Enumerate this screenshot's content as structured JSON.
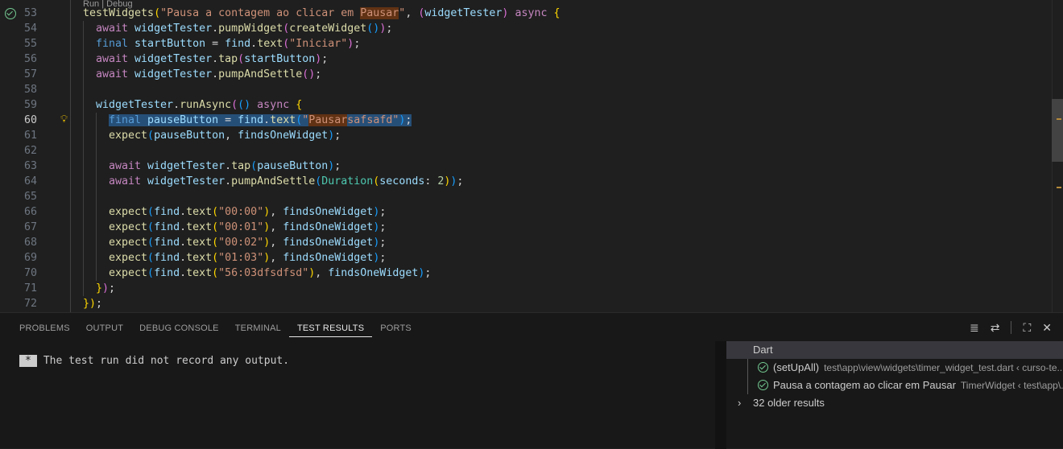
{
  "editor": {
    "codelens": "Run | Debug",
    "lines": [
      {
        "n": "53",
        "indent": 2,
        "tokens": [
          [
            "testWidgets",
            "f"
          ],
          [
            "(",
            "y"
          ],
          [
            "\"Pausa a contagem ao clicar em ",
            "s"
          ],
          [
            "Pausar",
            "s match"
          ],
          [
            "\"",
            "s"
          ],
          [
            ", ",
            "p"
          ],
          [
            "(",
            "m"
          ],
          [
            "widgetTester",
            "v"
          ],
          [
            ")",
            "m"
          ],
          [
            " async ",
            "k"
          ],
          [
            "{",
            "y"
          ]
        ]
      },
      {
        "n": "54",
        "indent": 4,
        "tokens": [
          [
            "await ",
            "k"
          ],
          [
            "widgetTester",
            "v"
          ],
          [
            ".",
            "p"
          ],
          [
            "pumpWidget",
            "f"
          ],
          [
            "(",
            "m"
          ],
          [
            "createWidget",
            "f"
          ],
          [
            "()",
            "c"
          ],
          [
            ")",
            "m"
          ],
          [
            ";",
            "p"
          ]
        ]
      },
      {
        "n": "55",
        "indent": 4,
        "tokens": [
          [
            "final ",
            "b"
          ],
          [
            "startButton",
            "v"
          ],
          [
            " = ",
            "p"
          ],
          [
            "find",
            "v"
          ],
          [
            ".",
            "p"
          ],
          [
            "text",
            "f"
          ],
          [
            "(",
            "m"
          ],
          [
            "\"Iniciar\"",
            "s"
          ],
          [
            ")",
            "m"
          ],
          [
            ";",
            "p"
          ]
        ]
      },
      {
        "n": "56",
        "indent": 4,
        "tokens": [
          [
            "await ",
            "k"
          ],
          [
            "widgetTester",
            "v"
          ],
          [
            ".",
            "p"
          ],
          [
            "tap",
            "f"
          ],
          [
            "(",
            "m"
          ],
          [
            "startButton",
            "v"
          ],
          [
            ")",
            "m"
          ],
          [
            ";",
            "p"
          ]
        ]
      },
      {
        "n": "57",
        "indent": 4,
        "tokens": [
          [
            "await ",
            "k"
          ],
          [
            "widgetTester",
            "v"
          ],
          [
            ".",
            "p"
          ],
          [
            "pumpAndSettle",
            "f"
          ],
          [
            "()",
            "m"
          ],
          [
            ";",
            "p"
          ]
        ]
      },
      {
        "n": "58",
        "indent": 0,
        "tokens": []
      },
      {
        "n": "59",
        "indent": 4,
        "tokens": [
          [
            "widgetTester",
            "v"
          ],
          [
            ".",
            "p"
          ],
          [
            "runAsync",
            "f"
          ],
          [
            "(",
            "m"
          ],
          [
            "()",
            "c"
          ],
          [
            " async ",
            "k"
          ],
          [
            "{",
            "y"
          ]
        ]
      },
      {
        "n": "60",
        "indent": 6,
        "current": true,
        "tokens": [
          [
            "final ",
            "b hl"
          ],
          [
            "pauseButton",
            "v hl"
          ],
          [
            " = ",
            "p hl"
          ],
          [
            "find",
            "v hl"
          ],
          [
            ".",
            "p hl"
          ],
          [
            "text",
            "f hl"
          ],
          [
            "(",
            "c hl"
          ],
          [
            "\"",
            "s hl"
          ],
          [
            "Pausar",
            "s hl match"
          ],
          [
            "safsafd\"",
            "s hl"
          ],
          [
            ")",
            "c hl"
          ],
          [
            ";",
            "p hl"
          ]
        ]
      },
      {
        "n": "61",
        "indent": 6,
        "tokens": [
          [
            "expect",
            "f"
          ],
          [
            "(",
            "c"
          ],
          [
            "pauseButton",
            "v"
          ],
          [
            ", ",
            "p"
          ],
          [
            "findsOneWidget",
            "v"
          ],
          [
            ")",
            "c"
          ],
          [
            ";",
            "p"
          ]
        ]
      },
      {
        "n": "62",
        "indent": 0,
        "tokens": []
      },
      {
        "n": "63",
        "indent": 6,
        "tokens": [
          [
            "await ",
            "k"
          ],
          [
            "widgetTester",
            "v"
          ],
          [
            ".",
            "p"
          ],
          [
            "tap",
            "f"
          ],
          [
            "(",
            "c"
          ],
          [
            "pauseButton",
            "v"
          ],
          [
            ")",
            "c"
          ],
          [
            ";",
            "p"
          ]
        ]
      },
      {
        "n": "64",
        "indent": 6,
        "tokens": [
          [
            "await ",
            "k"
          ],
          [
            "widgetTester",
            "v"
          ],
          [
            ".",
            "p"
          ],
          [
            "pumpAndSettle",
            "f"
          ],
          [
            "(",
            "c"
          ],
          [
            "Duration",
            "t"
          ],
          [
            "(",
            "y"
          ],
          [
            "seconds",
            "v"
          ],
          [
            ": ",
            "p"
          ],
          [
            "2",
            "n"
          ],
          [
            ")",
            "y"
          ],
          [
            ")",
            "c"
          ],
          [
            ";",
            "p"
          ]
        ]
      },
      {
        "n": "65",
        "indent": 0,
        "tokens": []
      },
      {
        "n": "66",
        "indent": 6,
        "tokens": [
          [
            "expect",
            "f"
          ],
          [
            "(",
            "c"
          ],
          [
            "find",
            "v"
          ],
          [
            ".",
            "p"
          ],
          [
            "text",
            "f"
          ],
          [
            "(",
            "y"
          ],
          [
            "\"00:00\"",
            "s"
          ],
          [
            ")",
            "y"
          ],
          [
            ", ",
            "p"
          ],
          [
            "findsOneWidget",
            "v"
          ],
          [
            ")",
            "c"
          ],
          [
            ";",
            "p"
          ]
        ]
      },
      {
        "n": "67",
        "indent": 6,
        "tokens": [
          [
            "expect",
            "f"
          ],
          [
            "(",
            "c"
          ],
          [
            "find",
            "v"
          ],
          [
            ".",
            "p"
          ],
          [
            "text",
            "f"
          ],
          [
            "(",
            "y"
          ],
          [
            "\"00:01\"",
            "s"
          ],
          [
            ")",
            "y"
          ],
          [
            ", ",
            "p"
          ],
          [
            "findsOneWidget",
            "v"
          ],
          [
            ")",
            "c"
          ],
          [
            ";",
            "p"
          ]
        ]
      },
      {
        "n": "68",
        "indent": 6,
        "tokens": [
          [
            "expect",
            "f"
          ],
          [
            "(",
            "c"
          ],
          [
            "find",
            "v"
          ],
          [
            ".",
            "p"
          ],
          [
            "text",
            "f"
          ],
          [
            "(",
            "y"
          ],
          [
            "\"00:02\"",
            "s"
          ],
          [
            ")",
            "y"
          ],
          [
            ", ",
            "p"
          ],
          [
            "findsOneWidget",
            "v"
          ],
          [
            ")",
            "c"
          ],
          [
            ";",
            "p"
          ]
        ]
      },
      {
        "n": "69",
        "indent": 6,
        "tokens": [
          [
            "expect",
            "f"
          ],
          [
            "(",
            "c"
          ],
          [
            "find",
            "v"
          ],
          [
            ".",
            "p"
          ],
          [
            "text",
            "f"
          ],
          [
            "(",
            "y"
          ],
          [
            "\"01:03\"",
            "s"
          ],
          [
            ")",
            "y"
          ],
          [
            ", ",
            "p"
          ],
          [
            "findsOneWidget",
            "v"
          ],
          [
            ")",
            "c"
          ],
          [
            ";",
            "p"
          ]
        ]
      },
      {
        "n": "70",
        "indent": 6,
        "tokens": [
          [
            "expect",
            "f"
          ],
          [
            "(",
            "c"
          ],
          [
            "find",
            "v"
          ],
          [
            ".",
            "p"
          ],
          [
            "text",
            "f"
          ],
          [
            "(",
            "y"
          ],
          [
            "\"56:03dfsdfsd\"",
            "s"
          ],
          [
            ")",
            "y"
          ],
          [
            ", ",
            "p"
          ],
          [
            "findsOneWidget",
            "v"
          ],
          [
            ")",
            "c"
          ],
          [
            ";",
            "p"
          ]
        ]
      },
      {
        "n": "71",
        "indent": 4,
        "tokens": [
          [
            "}",
            "y"
          ],
          [
            ")",
            "m"
          ],
          [
            ";",
            "p"
          ]
        ]
      },
      {
        "n": "72",
        "indent": 2,
        "tokens": [
          [
            "}",
            "y"
          ],
          [
            ")",
            "y"
          ],
          [
            ";",
            "p"
          ]
        ]
      }
    ]
  },
  "panel": {
    "tabs": [
      "PROBLEMS",
      "OUTPUT",
      "DEBUG CONSOLE",
      "TERMINAL",
      "TEST RESULTS",
      "PORTS"
    ],
    "active_tab": "TEST RESULTS",
    "output_marker": "*",
    "output_text": "The test run did not record any output.",
    "tree": {
      "group": "Dart",
      "items": [
        {
          "label": "(setUpAll)",
          "desc": "test\\app\\view\\widgets\\timer_widget_test.dart ‹ curso-te..."
        },
        {
          "label": "Pausa a contagem ao clicar em Pausar",
          "desc": "TimerWidget ‹ test\\app\\..."
        }
      ],
      "older": "32 older results"
    }
  }
}
